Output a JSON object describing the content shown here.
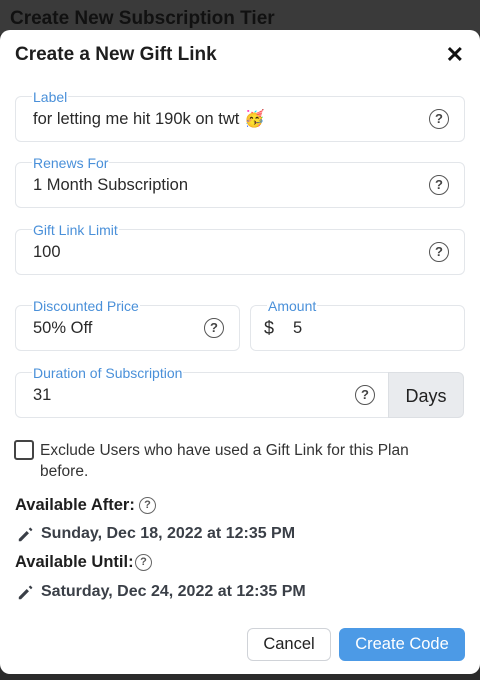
{
  "background": {
    "title": "Create New Subscription Tier"
  },
  "modal": {
    "title": "Create a New Gift Link",
    "fields": {
      "label": {
        "label": "Label",
        "value": "for letting me hit 190k on twt 🥳"
      },
      "renews": {
        "label": "Renews For",
        "value": "1 Month Subscription"
      },
      "limit": {
        "label": "Gift Link Limit",
        "value": "100"
      },
      "discount": {
        "label": "Discounted Price",
        "value": "50% Off"
      },
      "amount": {
        "label": "Amount",
        "currency": "$",
        "value": "5"
      },
      "duration": {
        "label": "Duration of Subscription",
        "value": "31",
        "unit": "Days"
      }
    },
    "exclude": {
      "label": "Exclude Users who have used a Gift Link for this Plan before.",
      "checked": false
    },
    "available_after": {
      "label": "Available After:",
      "date": "Sunday, Dec 18, 2022 at 12:35 PM"
    },
    "available_until": {
      "label": "Available Until:",
      "date": "Saturday, Dec 24, 2022 at 12:35 PM"
    },
    "buttons": {
      "cancel": "Cancel",
      "create": "Create Code"
    }
  },
  "icons": {
    "close": "close-icon",
    "help": "question-circle-icon",
    "edit": "pencil-icon",
    "help_glyph": "?",
    "close_glyph": "✕"
  },
  "colors": {
    "accent": "#4c9ae6",
    "label_blue": "#4a90d9"
  }
}
